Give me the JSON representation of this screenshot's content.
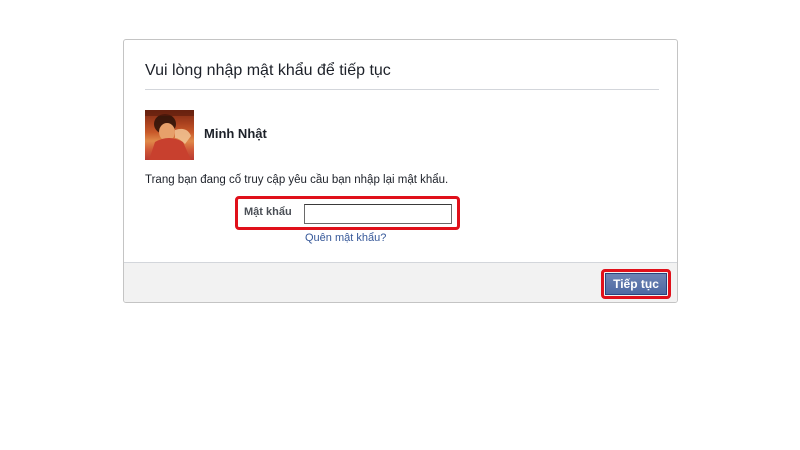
{
  "dialog": {
    "title": "Vui lòng nhập mật khẩu để tiếp tục",
    "user": {
      "name": "Minh Nhật",
      "avatar": "profile-photo"
    },
    "message": "Trang bạn đang cố truy cập yêu cầu bạn nhập lại mật khẩu.",
    "password": {
      "label": "Mật khẩu",
      "value": "",
      "placeholder": ""
    },
    "forgot_link": "Quên mật khẩu?",
    "continue_label": "Tiếp tục"
  },
  "colors": {
    "highlight": "#e0101a",
    "button": "#4e69a2",
    "link": "#365899",
    "footer_bg": "#f2f2f2"
  }
}
